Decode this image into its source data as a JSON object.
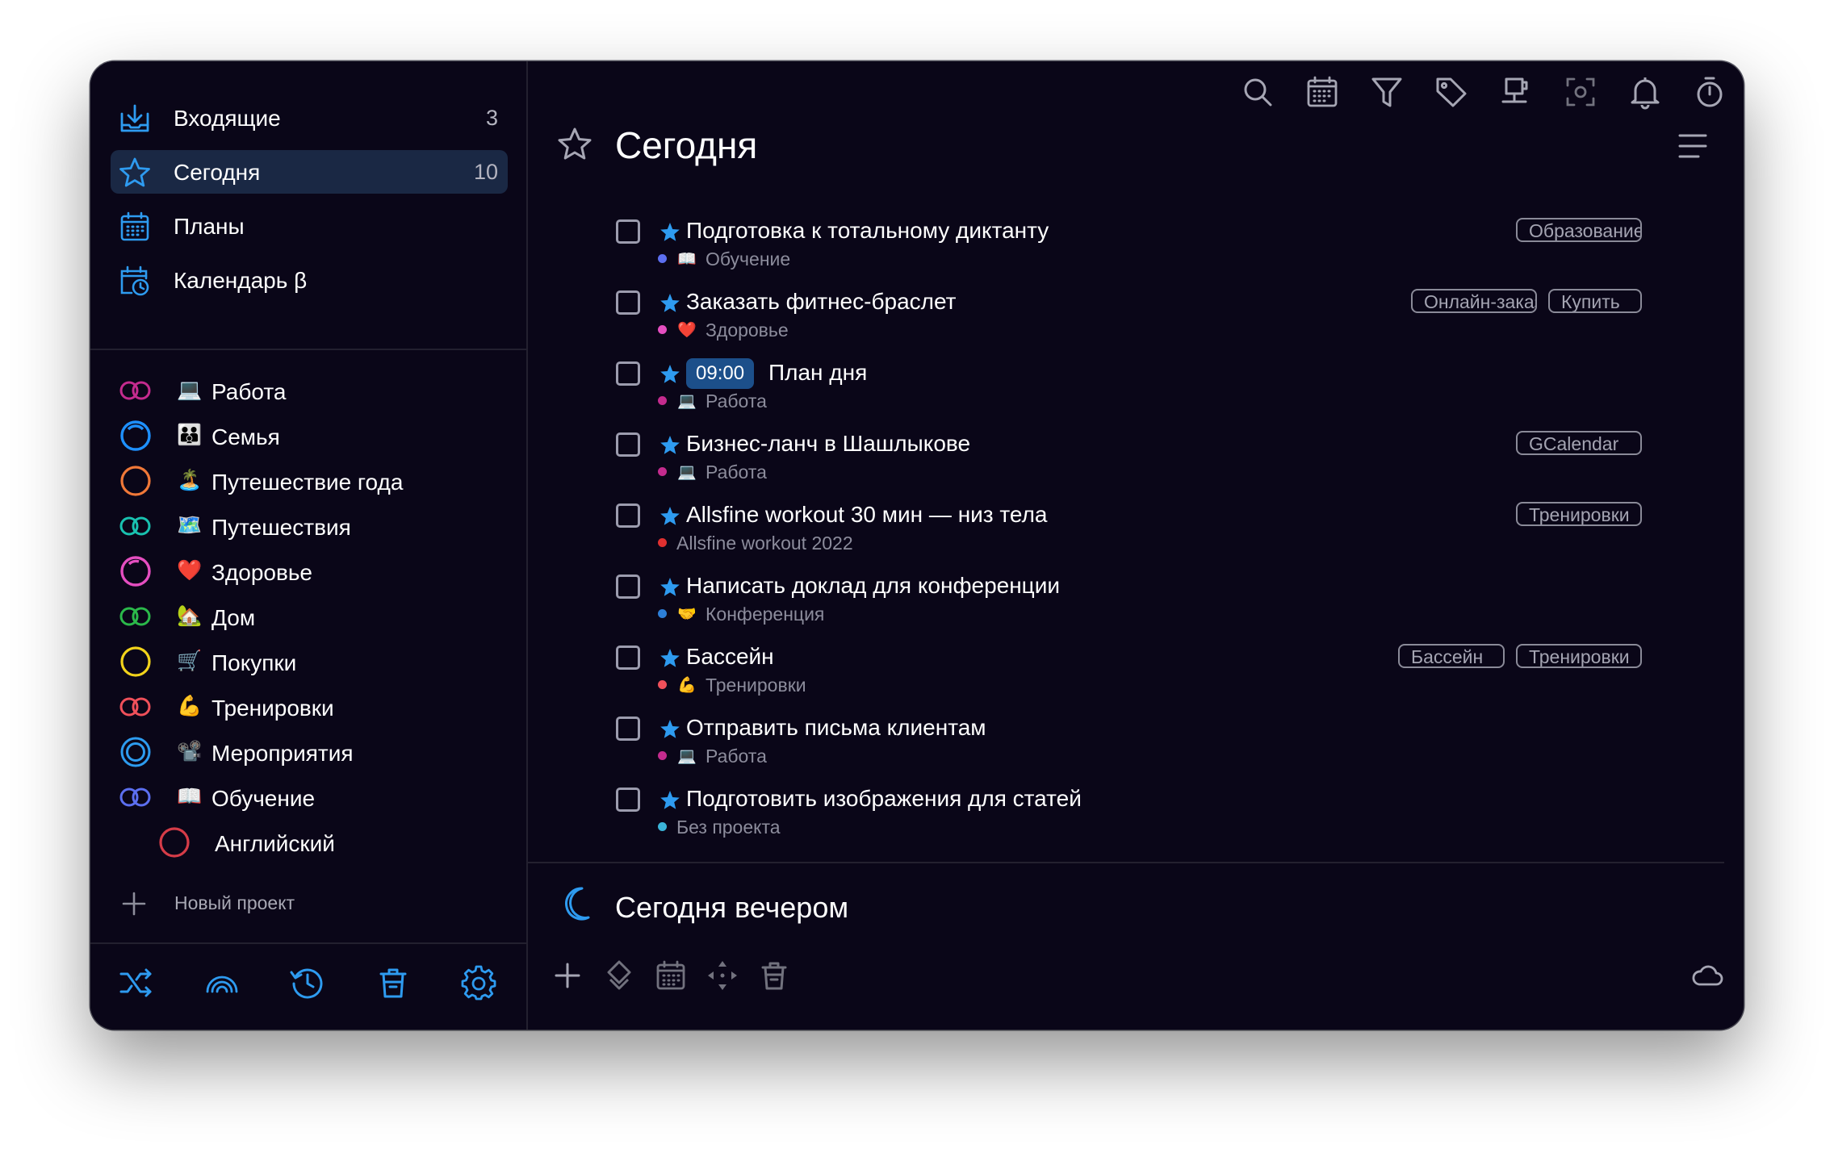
{
  "sidebar": {
    "nav": [
      {
        "label": "Входящие",
        "count": "3",
        "icon": "inbox-icon"
      },
      {
        "label": "Сегодня",
        "count": "10",
        "icon": "star-icon"
      },
      {
        "label": "Планы",
        "count": "",
        "icon": "calendar-grid-icon"
      },
      {
        "label": "Календарь β",
        "count": "",
        "icon": "calendar-clock-icon"
      }
    ],
    "projects": [
      {
        "label": "Работа",
        "emoji": "💻",
        "ring_color": "#c42b8e"
      },
      {
        "label": "Семья",
        "emoji": "👪",
        "ring_color": "#1e90ff"
      },
      {
        "label": "Путешествие года",
        "emoji": "🏝️",
        "ring_color": "#f07838"
      },
      {
        "label": "Путешествия",
        "emoji": "🗺️",
        "ring_color": "#19c2b0"
      },
      {
        "label": "Здоровье",
        "emoji": "❤️",
        "ring_color": "#e54ec0"
      },
      {
        "label": "Дом",
        "emoji": "🏡",
        "ring_color": "#2bb84a"
      },
      {
        "label": "Покупки",
        "emoji": "🛒",
        "ring_color": "#f2d31b"
      },
      {
        "label": "Тренировки",
        "emoji": "💪",
        "ring_color": "#f0505a"
      },
      {
        "label": "Мероприятия",
        "emoji": "📽️",
        "ring_color": "#2d9cf0"
      },
      {
        "label": "Обучение",
        "emoji": "📖",
        "ring_color": "#5c6ff0"
      },
      {
        "label": "Английский",
        "emoji": "",
        "ring_color": "#d63c48"
      }
    ],
    "new_project_label": "Новый проект",
    "bottom_icons": [
      "shuffle-icon",
      "rainbow-icon",
      "history-icon",
      "trash-icon",
      "gear-icon"
    ]
  },
  "main": {
    "title": "Сегодня",
    "toolbar_icons": [
      "search-icon",
      "calendar-icon",
      "filter-icon",
      "tag-icon",
      "coffee-icon",
      "focus-icon",
      "bell-icon",
      "timer-icon",
      "copy-icon"
    ],
    "tasks": [
      {
        "title": "Подготовка к тотальному диктанту",
        "time": "",
        "project": "Обучение",
        "emoji": "📖",
        "dot_color": "#5c6ff0",
        "tags": [
          "Образование"
        ]
      },
      {
        "title": "Заказать фитнес-браслет",
        "time": "",
        "project": "Здоровье",
        "emoji": "❤️",
        "dot_color": "#e54ec0",
        "tags": [
          "Онлайн-заказ",
          "Купить"
        ]
      },
      {
        "title": "План дня",
        "time": "09:00",
        "project": "Работа",
        "emoji": "💻",
        "dot_color": "#c42b8e",
        "tags": []
      },
      {
        "title": "Бизнес-ланч в Шашлыкове",
        "time": "",
        "project": "Работа",
        "emoji": "💻",
        "dot_color": "#c42b8e",
        "tags": [
          "GCalendar"
        ]
      },
      {
        "title": "Allsfine workout 30 мин — низ тела",
        "time": "",
        "project": "Allsfine workout 2022",
        "emoji": "",
        "dot_color": "#e03030",
        "tags": [
          "Тренировки"
        ]
      },
      {
        "title": "Написать доклад для конференции",
        "time": "",
        "project": "Конференция",
        "emoji": "🤝",
        "dot_color": "#2d7fd8",
        "tags": []
      },
      {
        "title": "Бассейн",
        "time": "",
        "project": "Тренировки",
        "emoji": "💪",
        "dot_color": "#f0505a",
        "tags": [
          "Бассейн",
          "Тренировки"
        ]
      },
      {
        "title": "Отправить письма клиентам",
        "time": "",
        "project": "Работа",
        "emoji": "💻",
        "dot_color": "#c42b8e",
        "tags": []
      },
      {
        "title": "Подготовить изображения для статей",
        "time": "",
        "project": "Без проекта",
        "emoji": "",
        "dot_color": "#3bb4d8",
        "tags": []
      }
    ],
    "evening_title": "Сегодня вечером",
    "bottom_icons": [
      "add-icon",
      "priority-icon",
      "calendar-icon",
      "move-icon",
      "trash-icon",
      "cloud-icon"
    ]
  },
  "colors": {
    "accent": "#2e9bf0",
    "background": "#0a0618",
    "selected": "#1a2844"
  }
}
